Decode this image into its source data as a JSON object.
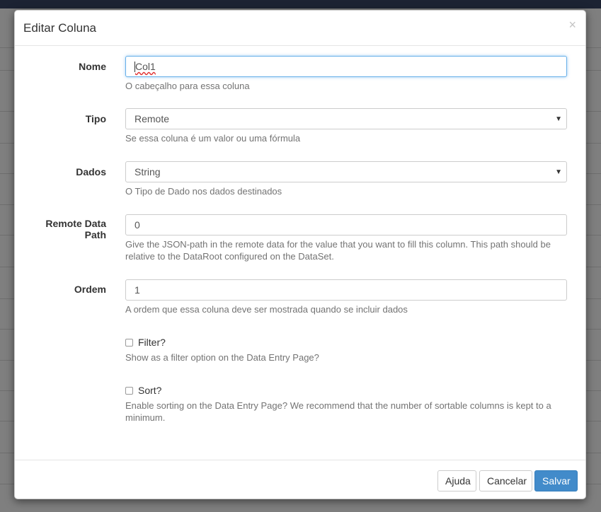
{
  "modal": {
    "title": "Editar Coluna",
    "close_label": "×"
  },
  "fields": {
    "nome": {
      "label": "Nome",
      "value": "Col1",
      "help": "O cabeçalho para essa coluna"
    },
    "tipo": {
      "label": "Tipo",
      "selected": "Remote",
      "help": "Se essa coluna é um valor ou uma fórmula"
    },
    "dados": {
      "label": "Dados",
      "selected": "String",
      "help": "O Tipo de Dado nos dados destinados"
    },
    "remote_path": {
      "label_line1": "Remote Data",
      "label_line2": "Path",
      "value": "0",
      "help": "Give the JSON-path in the remote data for the value that you want to fill this column. This path should be relative to the DataRoot configured on the DataSet."
    },
    "ordem": {
      "label": "Ordem",
      "value": "1",
      "help": "A ordem que essa coluna deve ser mostrada quando se incluir dados"
    },
    "filter": {
      "label": "Filter?",
      "checked": false,
      "help": "Show as a filter option on the Data Entry Page?"
    },
    "sort": {
      "label": "Sort?",
      "checked": false,
      "help": "Enable sorting on the Data Entry Page? We recommend that the number of sortable columns is kept to a minimum."
    }
  },
  "footer": {
    "help_label": "Ajuda",
    "cancel_label": "Cancelar",
    "save_label": "Salvar"
  },
  "colors": {
    "primary": "#428bca",
    "focus_border": "#66afe9",
    "topbar": "#1c2333"
  },
  "icons": {
    "close": "close-icon",
    "select_caret": "caret-down-icon"
  }
}
